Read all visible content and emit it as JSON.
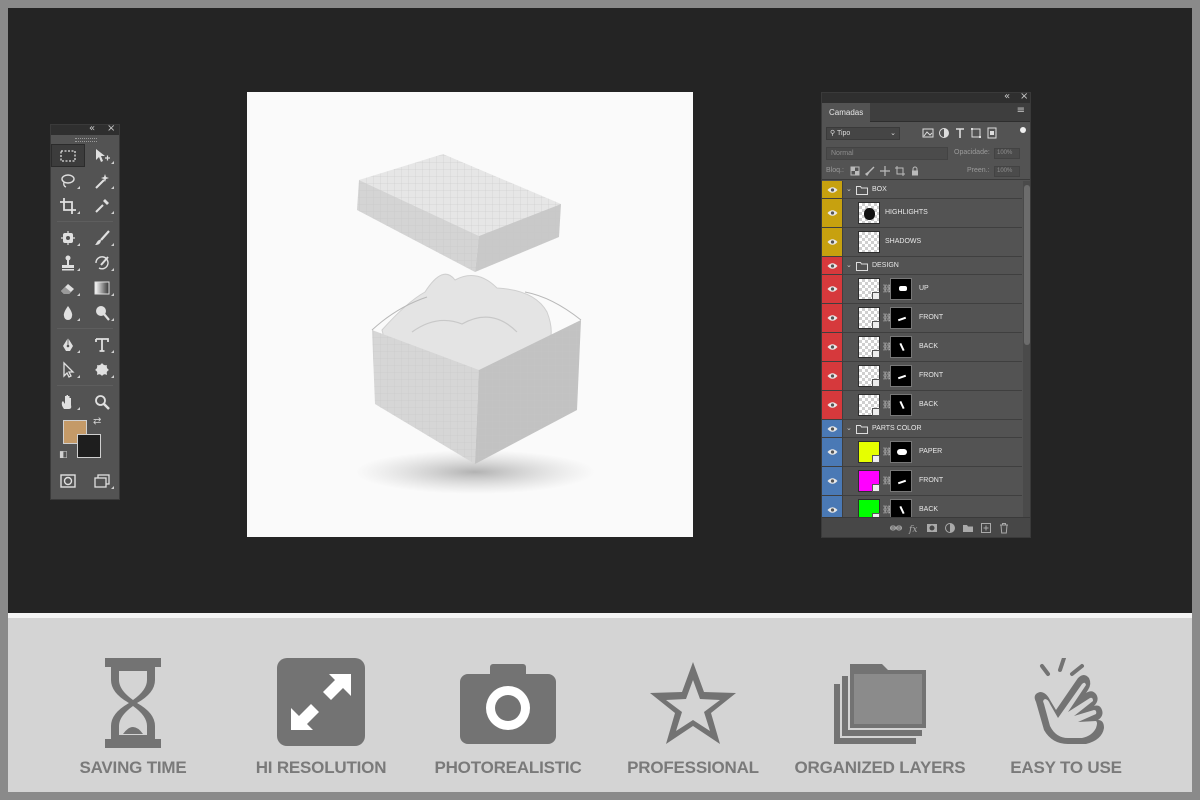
{
  "layers_panel": {
    "tab_label": "Camadas",
    "kind_filter": "Tipo",
    "blend_mode": "Normal",
    "opacity_label": "Opacidade:",
    "opacity_value": "100%",
    "lock_label": "Bloq.:",
    "fill_label": "Preen.:",
    "fill_value": "100%",
    "groups": [
      {
        "name": "BOX",
        "tag_color": "#c7a10f",
        "children": [
          {
            "name": "HIGHLIGHTS",
            "mask": false
          },
          {
            "name": "SHADOWS",
            "mask": false
          }
        ]
      },
      {
        "name": "DESIGN",
        "tag_color": "#d6393c",
        "children": [
          {
            "name": "UP",
            "mask": true
          },
          {
            "name": "FRONT",
            "mask": true
          },
          {
            "name": "BACK",
            "mask": true
          },
          {
            "name": "FRONT",
            "mask": true
          },
          {
            "name": "BACK",
            "mask": true
          }
        ]
      },
      {
        "name": "PARTS COLOR",
        "tag_color": "#4a79b5",
        "children": [
          {
            "name": "PAPER",
            "mask": true,
            "fill_color": "#e6ff00"
          },
          {
            "name": "FRONT",
            "mask": true,
            "fill_color": "#ff00ff"
          },
          {
            "name": "BACK",
            "mask": true,
            "fill_color": "#00ff00"
          }
        ]
      }
    ]
  },
  "toolbar": {
    "foreground_color": "#c49a68",
    "background_color": "#1e1e1e"
  },
  "features": [
    {
      "label": "SAVING TIME",
      "icon": "hourglass-icon"
    },
    {
      "label": "HI RESOLUTION",
      "icon": "expand-arrows-icon"
    },
    {
      "label": "PHOTOREALISTIC",
      "icon": "camera-icon"
    },
    {
      "label": "PROFESSIONAL",
      "icon": "star-icon"
    },
    {
      "label": "ORGANIZED LAYERS",
      "icon": "stacked-folders-icon"
    },
    {
      "label": "EASY TO USE",
      "icon": "tap-hand-icon"
    }
  ],
  "colors": {
    "workspace": "#242424",
    "panel": "#535353",
    "feature_icon": "#737373",
    "feature_strip": "#d4d4d4"
  }
}
